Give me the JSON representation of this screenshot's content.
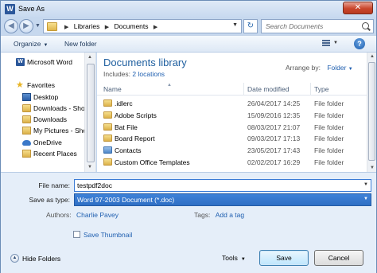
{
  "window": {
    "title": "Save As",
    "app_icon_letter": "W",
    "close_glyph": "✕"
  },
  "address": {
    "back_glyph": "◀",
    "forward_glyph": "▶",
    "crumbs": [
      "Libraries",
      "Documents"
    ],
    "refresh_glyph": "↻",
    "search_placeholder": "Search Documents"
  },
  "toolbar": {
    "organize_label": "Organize",
    "new_folder_label": "New folder",
    "help_glyph": "?"
  },
  "nav": {
    "items": [
      {
        "label": "Microsoft Word",
        "icon": "word-icon"
      },
      {
        "label": "Favorites",
        "icon": "star-icon"
      },
      {
        "label": "Desktop",
        "icon": "desktop-icon"
      },
      {
        "label": "Downloads - Sho",
        "icon": "folder-icon"
      },
      {
        "label": "Downloads",
        "icon": "folder-icon"
      },
      {
        "label": "My Pictures - Sho",
        "icon": "pictures-icon"
      },
      {
        "label": "OneDrive",
        "icon": "onedrive-icon"
      },
      {
        "label": "Recent Places",
        "icon": "recent-places-icon"
      }
    ]
  },
  "library": {
    "title": "Documents library",
    "includes_label": "Includes:",
    "includes_link": "2 locations",
    "arrange_label": "Arrange by:",
    "arrange_value": "Folder"
  },
  "columns": {
    "name": "Name",
    "date": "Date modified",
    "type": "Type"
  },
  "files": [
    {
      "name": ".idlerc",
      "date": "26/04/2017 14:25",
      "type": "File folder"
    },
    {
      "name": "Adobe Scripts",
      "date": "15/09/2016 12:35",
      "type": "File folder"
    },
    {
      "name": "Bat File",
      "date": "08/03/2017 21:07",
      "type": "File folder"
    },
    {
      "name": "Board Report",
      "date": "09/03/2017 17:13",
      "type": "File folder"
    },
    {
      "name": "Contacts",
      "date": "23/05/2017 17:43",
      "type": "File folder"
    },
    {
      "name": "Custom Office Templates",
      "date": "02/02/2017 16:29",
      "type": "File folder"
    }
  ],
  "form": {
    "filename_label": "File name:",
    "filename_value": "testpdf2doc",
    "savetype_label": "Save as type:",
    "savetype_value": "Word 97-2003 Document (*.doc)",
    "authors_label": "Authors:",
    "authors_value": "Charlie Pavey",
    "tags_label": "Tags:",
    "tags_value": "Add a tag",
    "thumbnail_label": "Save Thumbnail"
  },
  "bottom": {
    "hide_folders_label": "Hide Folders",
    "tools_label": "Tools",
    "save_label": "Save",
    "cancel_label": "Cancel"
  }
}
